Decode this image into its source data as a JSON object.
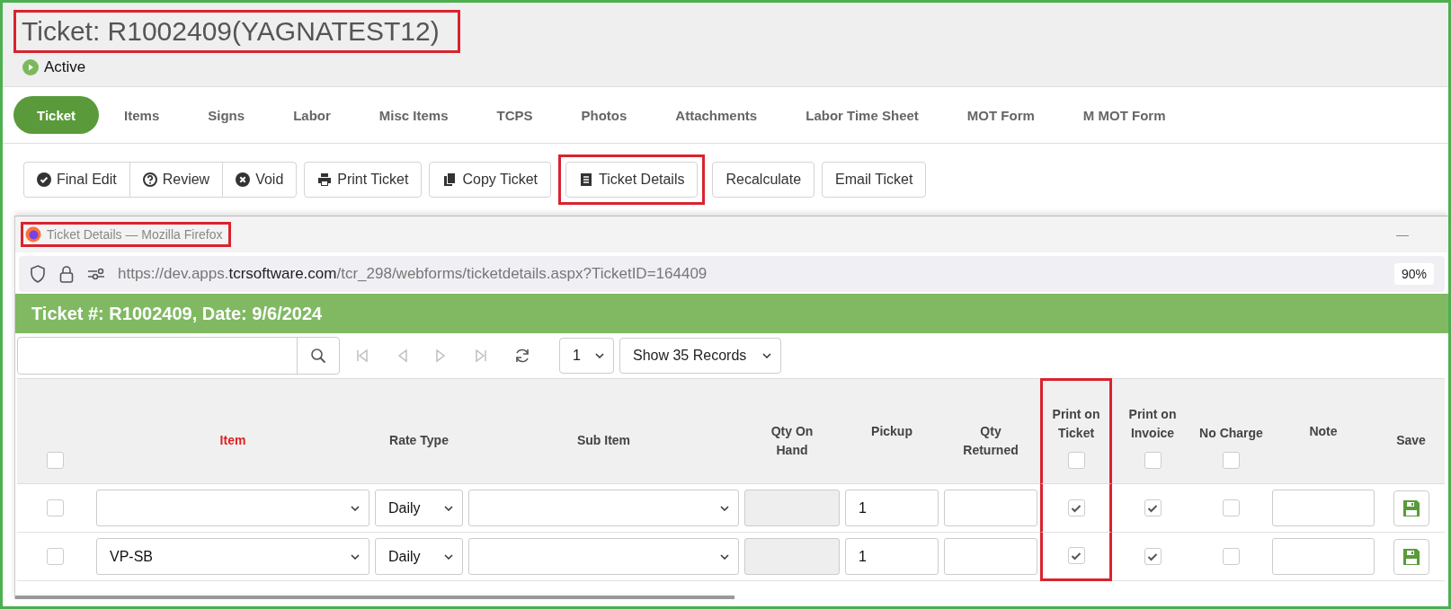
{
  "header": {
    "title": "Ticket: R1002409(YAGNATEST12)",
    "highlighted": true,
    "status": "Active"
  },
  "tabs": [
    {
      "label": "Ticket",
      "selected": true
    },
    {
      "label": "Items",
      "selected": false
    },
    {
      "label": "Signs",
      "selected": false
    },
    {
      "label": "Labor",
      "selected": false
    },
    {
      "label": "Misc Items",
      "selected": false
    },
    {
      "label": "TCPS",
      "selected": false
    },
    {
      "label": "Photos",
      "selected": false
    },
    {
      "label": "Attachments",
      "selected": false
    },
    {
      "label": "Labor Time Sheet",
      "selected": false
    },
    {
      "label": "MOT Form",
      "selected": false
    },
    {
      "label": "M MOT Form",
      "selected": false
    }
  ],
  "button_group": [
    {
      "label": "Final Edit",
      "kind": "check"
    },
    {
      "label": "Review",
      "kind": "question"
    },
    {
      "label": "Void",
      "kind": "cross"
    }
  ],
  "buttons": [
    {
      "label": "Print Ticket",
      "kind": "print",
      "highlighted": false
    },
    {
      "label": "Copy Ticket",
      "kind": "copy",
      "highlighted": false
    },
    {
      "label": "Ticket Details",
      "kind": "document",
      "highlighted": true
    },
    {
      "label": "Recalculate",
      "kind": "none",
      "highlighted": false
    },
    {
      "label": "Email Ticket",
      "kind": "none",
      "highlighted": false
    }
  ],
  "popup": {
    "window_title": "Ticket Details — Mozilla Firefox",
    "title_highlighted": true,
    "minimize": "—",
    "url": {
      "prefix": "https://dev.apps.",
      "domain": "tcrsoftware.com",
      "path": "/tcr_298/webforms/ticketdetails.aspx?TicketID=164409",
      "zoom": "90%"
    },
    "banner": "Ticket #: R1002409, Date: 9/6/2024",
    "pager": {
      "page": "1",
      "page_size": "Show 35 Records"
    },
    "grid": {
      "columns": [
        {
          "kind": "select",
          "checked": false,
          "highlighted": false
        },
        {
          "label": "Item",
          "kind": "dropdown",
          "required": true,
          "highlighted": false
        },
        {
          "label": "Rate Type",
          "kind": "dropdown",
          "required": false,
          "highlighted": false
        },
        {
          "label": "Sub Item",
          "kind": "dropdown",
          "required": false,
          "highlighted": false
        },
        {
          "label": "Qty On Hand",
          "kind": "readonly",
          "required": false,
          "highlighted": false
        },
        {
          "label": "Pickup",
          "kind": "input",
          "required": false,
          "highlighted": false
        },
        {
          "label": "Qty Returned",
          "kind": "input",
          "required": false,
          "highlighted": false
        },
        {
          "label": "Print on Ticket",
          "kind": "check",
          "checked": false,
          "required": false,
          "highlighted": true
        },
        {
          "label": "Print on Invoice",
          "kind": "check",
          "checked": false,
          "required": false,
          "highlighted": false
        },
        {
          "label": "No Charge",
          "kind": "check",
          "checked": false,
          "required": false,
          "highlighted": false
        },
        {
          "label": "Note",
          "kind": "input",
          "required": false,
          "highlighted": false
        },
        {
          "label": "Save",
          "kind": "save",
          "required": false,
          "highlighted": false
        }
      ],
      "rows": [
        {
          "cells": [
            {
              "checked": false
            },
            {},
            {
              "value": "Daily"
            },
            {},
            {},
            {
              "value": "1"
            },
            {},
            {
              "checked": true
            },
            {
              "checked": true
            },
            {
              "checked": false
            },
            {},
            {}
          ]
        },
        {
          "cells": [
            {
              "checked": false
            },
            {
              "value": "VP-SB"
            },
            {
              "value": "Daily"
            },
            {},
            {},
            {
              "value": "1"
            },
            {},
            {
              "checked": true
            },
            {
              "checked": true
            },
            {
              "checked": false
            },
            {},
            {}
          ]
        }
      ]
    }
  }
}
